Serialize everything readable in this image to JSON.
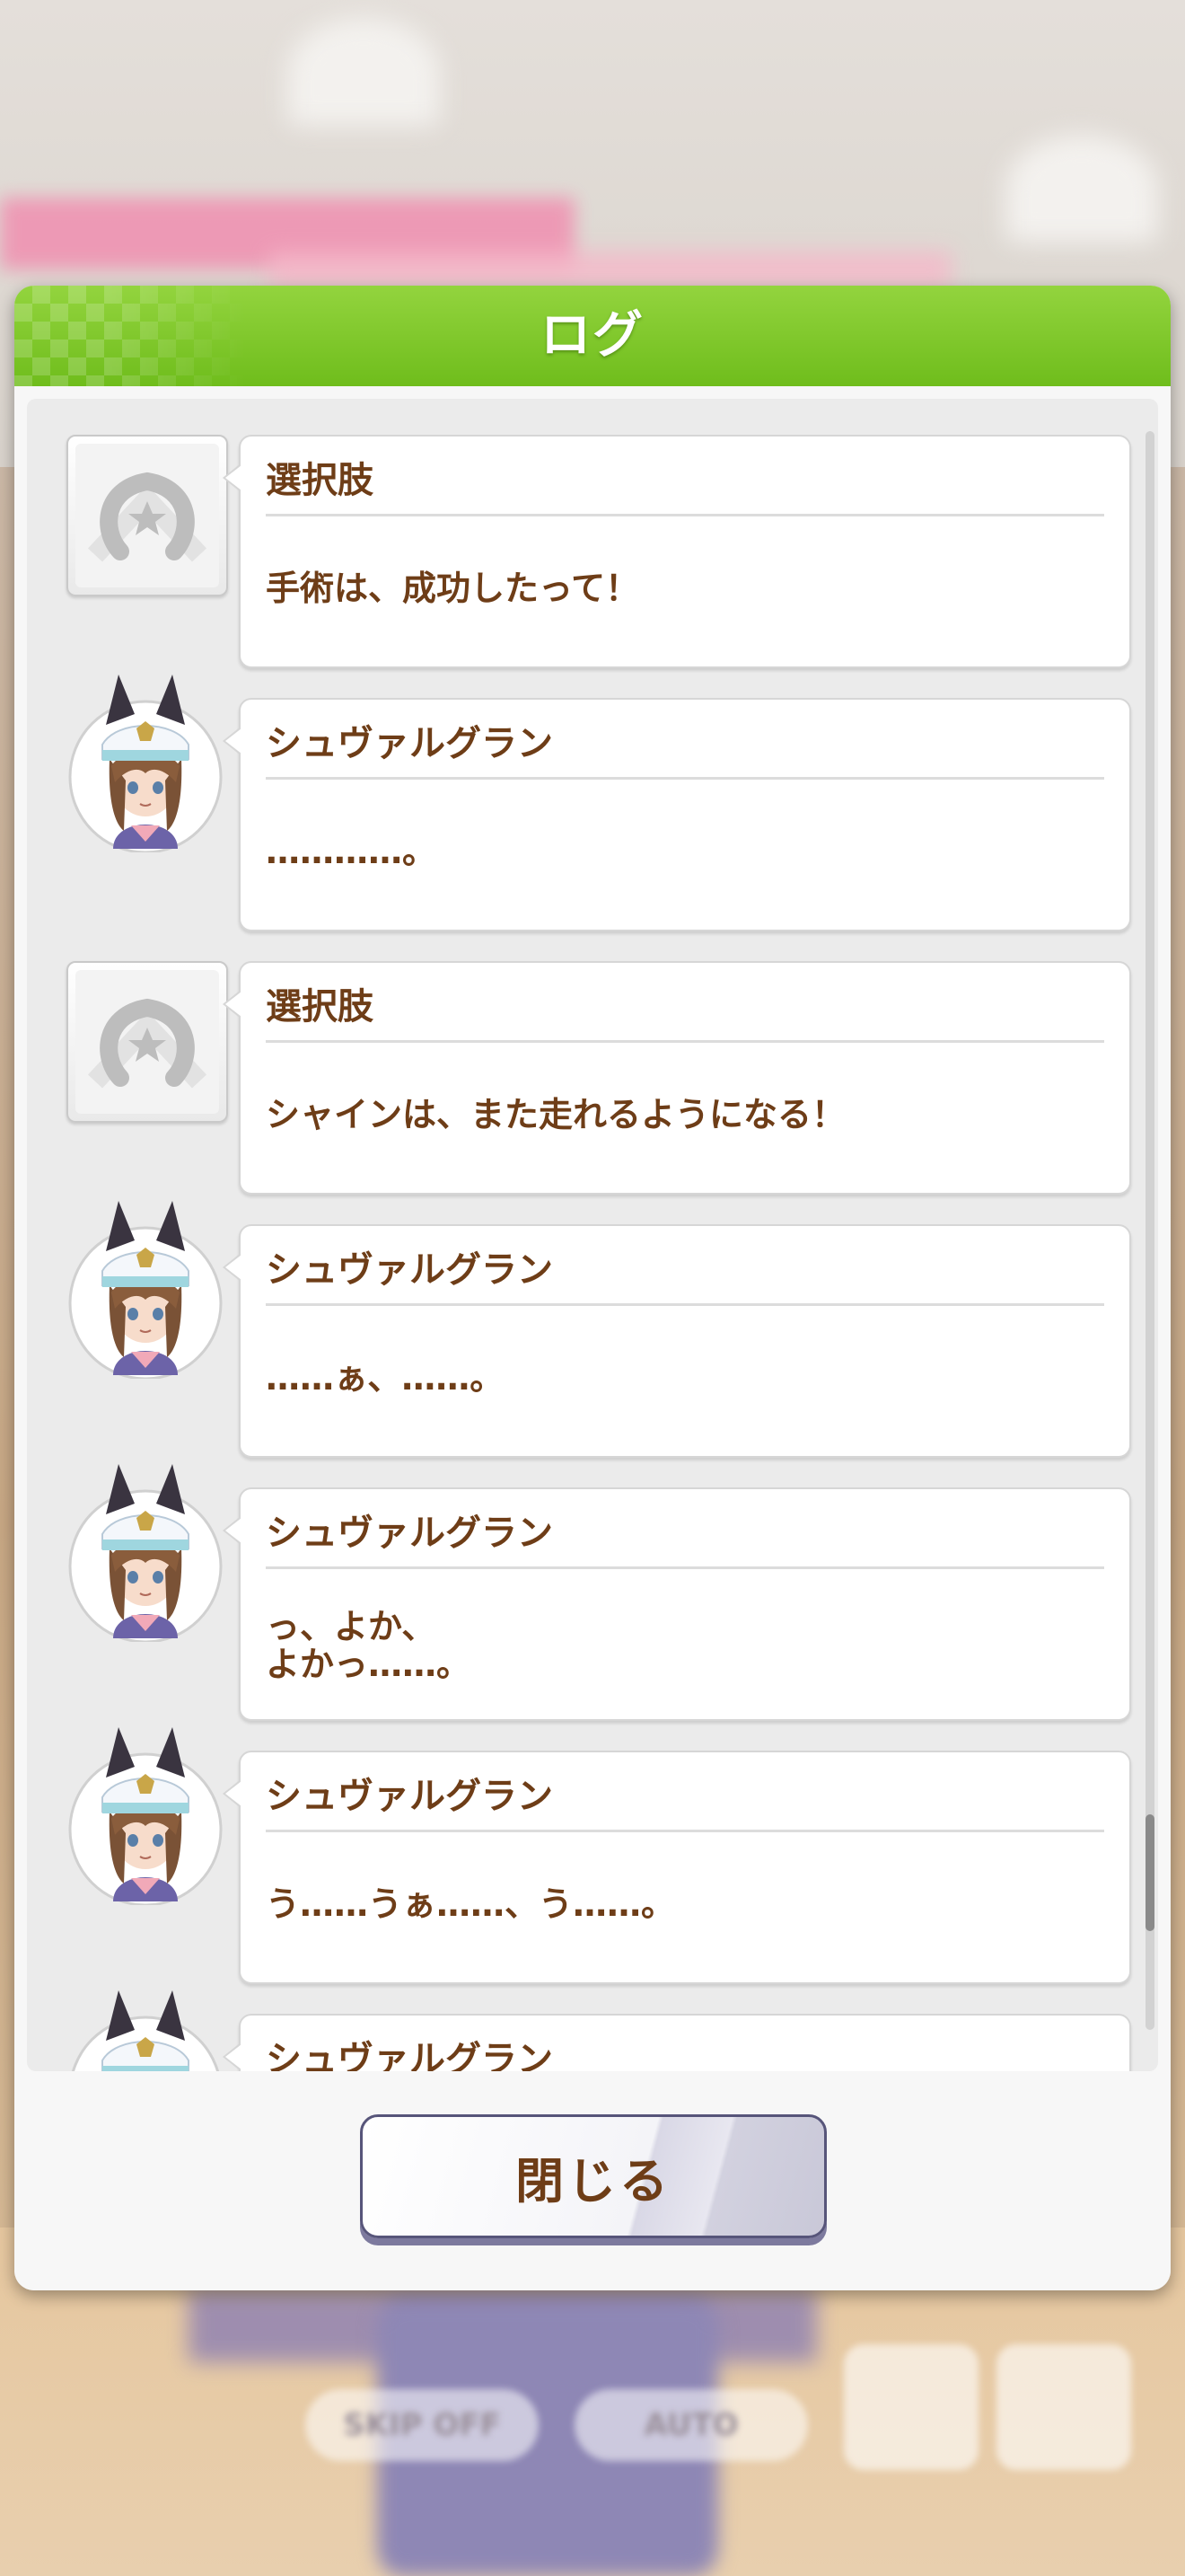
{
  "dialog": {
    "title": "ログ",
    "close_label": "閉じる"
  },
  "entries": [
    {
      "type": "choice",
      "speaker": "選択肢",
      "text": "手術は、成功したって！"
    },
    {
      "type": "character",
      "speaker": "シュヴァルグラン",
      "text": "…………。"
    },
    {
      "type": "choice",
      "speaker": "選択肢",
      "text": "シャインは、また走れるようになる！"
    },
    {
      "type": "character",
      "speaker": "シュヴァルグラン",
      "text": "……ぁ、……。"
    },
    {
      "type": "character",
      "speaker": "シュヴァルグラン",
      "text": "っ、よか、\nよかっ……。"
    },
    {
      "type": "character",
      "speaker": "シュヴァルグラン",
      "text": "う……うぁ……、う……。"
    },
    {
      "type": "character",
      "speaker": "シュヴァルグラン",
      "text": ""
    }
  ],
  "background": {
    "skip_label": "SKIP OFF",
    "auto_label": "AUTO"
  },
  "colors": {
    "header_green": "#7cc62a",
    "text_brown": "#6e3d17",
    "button_border": "#57557a"
  },
  "icons": {
    "choice": "horseshoe-star-icon",
    "character": "character-portrait-icon"
  }
}
